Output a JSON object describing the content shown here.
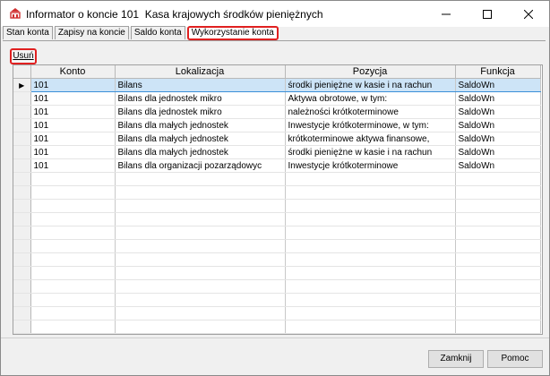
{
  "window": {
    "title": "Informator o koncie 101  Kasa krajowych środków pieniężnych"
  },
  "tabs": [
    "Stan konta",
    "Zapisy na koncie",
    "Saldo konta",
    "Wykorzystanie konta"
  ],
  "toolbar": {
    "delete_label": "Usuń"
  },
  "table": {
    "columns": [
      "Konto",
      "Lokalizacja",
      "Pozycja",
      "Funkcja"
    ],
    "rows": [
      [
        "101",
        "Bilans",
        "środki pieniężne w kasie i na rachun",
        "SaldoWn"
      ],
      [
        "101",
        "Bilans dla jednostek mikro",
        "Aktywa obrotowe, w tym:",
        "SaldoWn"
      ],
      [
        "101",
        "Bilans dla jednostek mikro",
        "należności krótkoterminowe",
        "SaldoWn"
      ],
      [
        "101",
        "Bilans dla małych jednostek",
        "Inwestycje krótkoterminowe, w tym:",
        "SaldoWn"
      ],
      [
        "101",
        "Bilans dla małych jednostek",
        "krótkoterminowe aktywa finansowe,",
        "SaldoWn"
      ],
      [
        "101",
        "Bilans dla małych jednostek",
        "środki pieniężne w kasie i na rachun",
        "SaldoWn"
      ],
      [
        "101",
        "Bilans dla organizacji pozarządowyc",
        "Inwestycje krótkoterminowe",
        "SaldoWn"
      ]
    ],
    "selected_row": 0
  },
  "footer": {
    "close_label": "Zamknij",
    "help_label": "Pomoc"
  }
}
